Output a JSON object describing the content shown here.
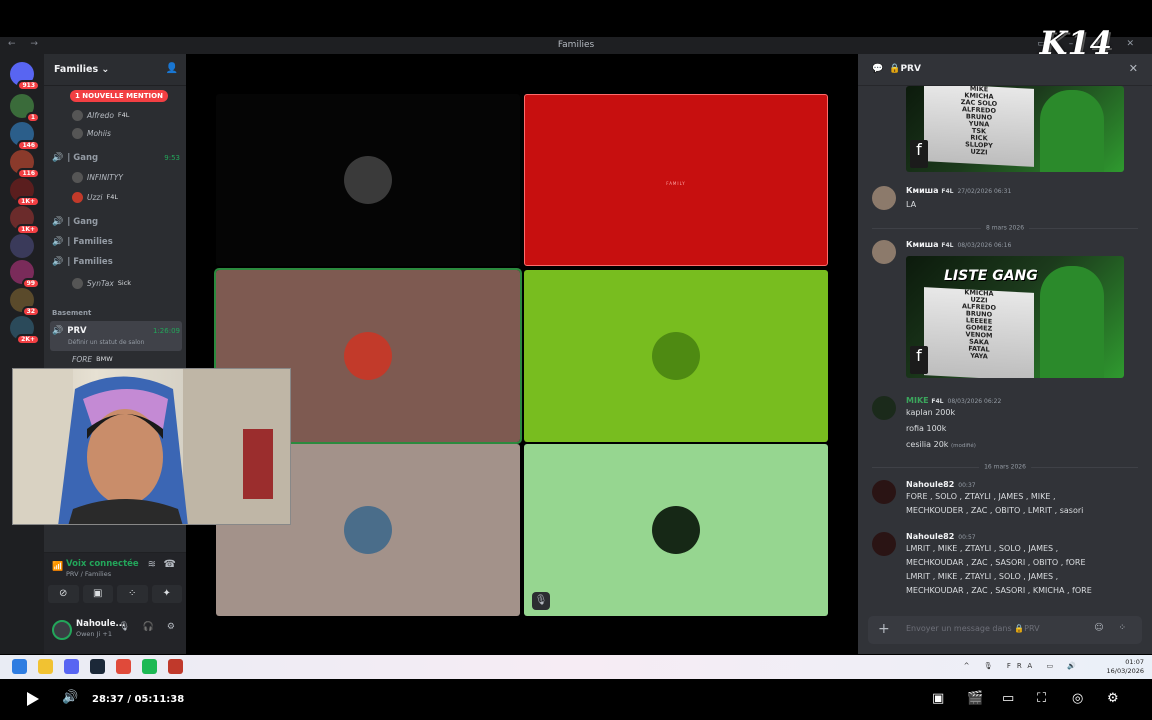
{
  "window": {
    "title": "Families"
  },
  "overlay_logo": "K14",
  "server_rail": [
    {
      "color": "#5865f2",
      "badge": "913"
    },
    {
      "color": "#3a6b3a",
      "badge": "1"
    },
    {
      "color": "#2b5e8a",
      "badge": "146"
    },
    {
      "color": "#8a3a2b",
      "badge": "116"
    },
    {
      "color": "#5a1e1e",
      "badge": "1K+"
    },
    {
      "color": "#6b2b2b",
      "badge": "1K+"
    },
    {
      "color": "#3a3a5a",
      "badge": ""
    },
    {
      "color": "#7a2b5a",
      "badge": "99"
    },
    {
      "color": "#5a4a2b",
      "badge": "32"
    },
    {
      "color": "#2b4a5a",
      "badge": "2K+"
    }
  ],
  "sidebar": {
    "guild_name": "Families",
    "mention_pill": "1 NOUVELLE MENTION",
    "members_top": [
      {
        "name": "Alfredo",
        "tag": "F4L"
      },
      {
        "name": "Mohiis",
        "tag": ""
      }
    ],
    "gang1": {
      "label": "| Gang",
      "time": "9:53"
    },
    "gang1_members": [
      {
        "name": "INFINITYY",
        "tag": ""
      },
      {
        "name": "Uzzi",
        "tag": "F4L"
      }
    ],
    "gang2": {
      "label": "| Gang"
    },
    "fam1": {
      "label": "| Families"
    },
    "fam2": {
      "label": "| Families"
    },
    "fam2_members": [
      {
        "name": "SynTax",
        "tag": "Sick"
      }
    ],
    "category": "Basement",
    "prv": {
      "label": "PRV",
      "time": "1:26:09"
    },
    "prv_status": "Définir un statut de salon",
    "prv_member": {
      "name": "FORE",
      "tag": "BMW"
    },
    "voice": {
      "status": "Voix connectée",
      "channel": "PRV / Families"
    },
    "user": {
      "name": "Nahoule...",
      "sub": "Owen Ji +1"
    }
  },
  "tiles": [
    {
      "bg": "#050505",
      "avatar": "#3a3a3a",
      "speaking": false
    },
    {
      "bg": "#c70f0f",
      "avatar": "",
      "speaking": false,
      "caption": "FAMILY"
    },
    {
      "bg": "#7e5a51",
      "avatar": "#c23a2a",
      "speaking": true
    },
    {
      "bg": "#78bd1f",
      "avatar": "#4e8a12",
      "speaking": false
    },
    {
      "bg": "#a3928a",
      "avatar": "#4a6d8a",
      "speaking": false
    },
    {
      "bg": "#96d690",
      "avatar": "#162816",
      "speaking": false,
      "muted": true
    }
  ],
  "chat": {
    "channel": "PRV",
    "embed1_list": [
      "MIKE",
      "KMICHA",
      "ZAC SOLO",
      "ALFREDO",
      "BRUNO",
      "YUNA",
      "TSK",
      "RICK",
      "SLLOPY",
      "UZZI"
    ],
    "msg1": {
      "author": "Кмиша",
      "tag": "F4L",
      "time": "27/02/2026 06:31",
      "text": "LA"
    },
    "divider1": "8 mars 2026",
    "msg2": {
      "author": "Кмиша",
      "tag": "F4L",
      "time": "08/03/2026 06:16"
    },
    "embed2_title": "LISTE GANG",
    "embed2_list": [
      "KMICHA",
      "UZZI",
      "ALFREDO",
      "BRUNO",
      "LEEEEE",
      "GOMEZ",
      "VENOM",
      "SAKA",
      "FATAL",
      "YAYA"
    ],
    "msg3": {
      "author": "MIKE",
      "tag": "F4L",
      "time": "08/03/2026 06:22",
      "lines": [
        "kaplan 200k",
        "rofia 100k",
        "cesilia 20k"
      ],
      "edited": "(modifié)"
    },
    "divider2": "16 mars 2026",
    "msg4": {
      "author": "Nahoule82",
      "time": "00:37",
      "lines": [
        "FORE , SOLO , ZTAYLI , JAMES , MIKE ,",
        "MECHKOUDER , ZAC , OBITO , LMRIT , sasori"
      ]
    },
    "msg5": {
      "author": "Nahoule82",
      "time": "00:57",
      "lines": [
        "LMRIT , MIKE , ZTAYLI , SOLO , JAMES ,",
        "MECHKOUDAR , ZAC , SASORI , OBITO , fORE",
        "LMRIT , MIKE , ZTAYLI , SOLO , JAMES ,",
        "MECHKOUDAR , ZAC , SASORI , KMICHA , fORE"
      ]
    },
    "composer_placeholder": "Envoyer un message dans 🔒PRV"
  },
  "taskbar": {
    "lang": "FRA",
    "time": "01:07",
    "date": "16/03/2026"
  },
  "player": {
    "time": "28:37 / 05:11:38"
  }
}
